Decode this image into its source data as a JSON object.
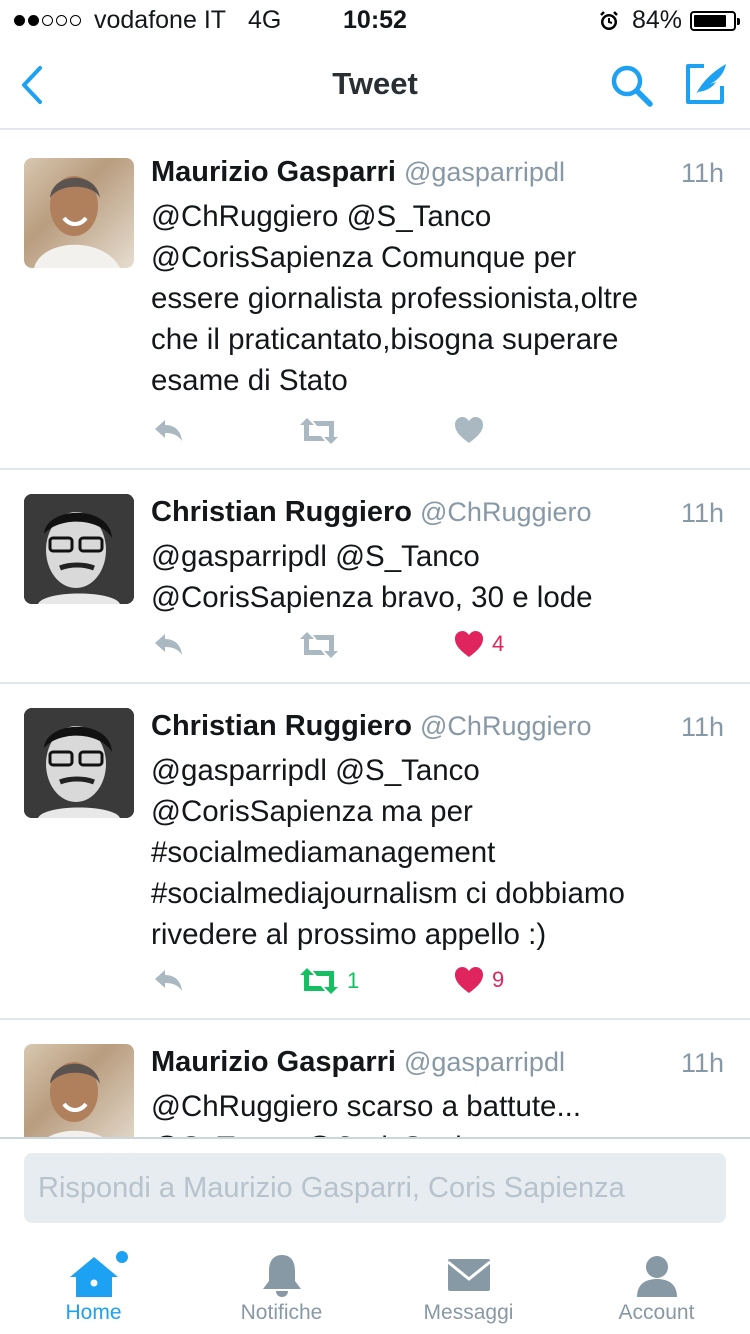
{
  "status_bar": {
    "carrier": "vodafone IT",
    "network": "4G",
    "time": "10:52",
    "battery": "84%",
    "battery_level": 0.84
  },
  "nav": {
    "title": "Tweet"
  },
  "tweets": [
    {
      "name": "Maurizio Gasparri",
      "handle": "@gasparripdl",
      "time": "11h",
      "lines": [
        "@ChRuggiero @S_Tanco",
        "@CorisSapienza Comunque per",
        "essere giornalista professionista,oltre",
        "che il praticantato,bisogna superare",
        "esame di Stato"
      ],
      "retweets": "",
      "likes": ""
    },
    {
      "name": "Christian Ruggiero",
      "handle": "@ChRuggiero",
      "time": "11h",
      "lines": [
        "@gasparripdl @S_Tanco",
        "@CorisSapienza bravo, 30 e lode"
      ],
      "retweets": "",
      "likes": "4"
    },
    {
      "name": "Christian Ruggiero",
      "handle": "@ChRuggiero",
      "time": "11h",
      "lines": [
        "@gasparripdl @S_Tanco",
        "@CorisSapienza ma per",
        "#socialmediamanagement",
        "#socialmediajournalism ci dobbiamo",
        "rivedere al prossimo appello :)"
      ],
      "retweets": "1",
      "likes": "9"
    },
    {
      "name": "Maurizio Gasparri",
      "handle": "@gasparripdl",
      "time": "11h",
      "lines": [
        "@ChRuggiero scarso a battute...",
        "@S_Tanco @CorisSapienza"
      ],
      "retweets": "",
      "likes": ""
    }
  ],
  "reply": {
    "placeholder": "Rispondi a Maurizio Gasparri, Coris Sapienza"
  },
  "tabs": [
    {
      "label": "Home",
      "icon": "home-icon",
      "active": true
    },
    {
      "label": "Notifiche",
      "icon": "bell-icon",
      "active": false
    },
    {
      "label": "Messaggi",
      "icon": "envelope-icon",
      "active": false
    },
    {
      "label": "Account",
      "icon": "person-icon",
      "active": false
    }
  ],
  "colors": {
    "accent": "#1da1f2",
    "like": "#e0245e",
    "retweet": "#17bf63",
    "muted": "#8899a6"
  }
}
